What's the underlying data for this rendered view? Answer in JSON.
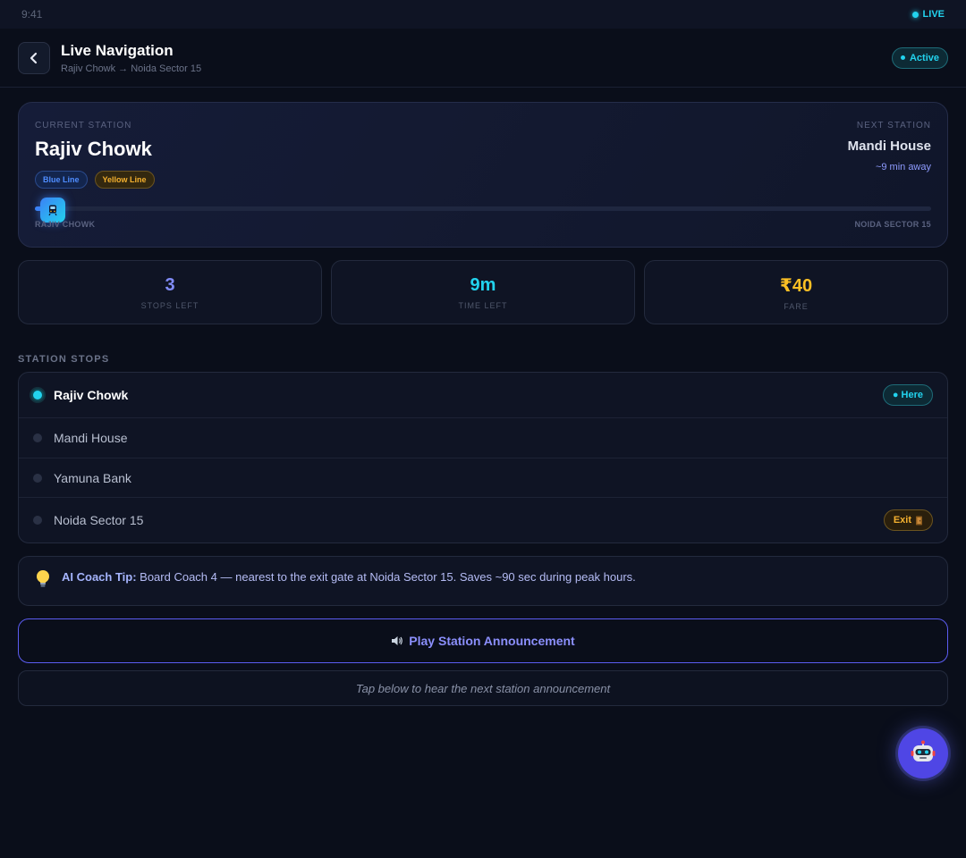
{
  "status": {
    "time": "9:41",
    "live": "LIVE"
  },
  "header": {
    "title": "Live Navigation",
    "subtitle": "Rajiv Chowk → Noida Sector 15",
    "badge": "Active"
  },
  "current": {
    "label": "CURRENT STATION",
    "name": "Rajiv Chowk",
    "lines": [
      "Blue Line",
      "Yellow Line"
    ]
  },
  "next": {
    "label": "NEXT STATION",
    "name": "Mandi House",
    "eta": "~9 min away"
  },
  "progress": {
    "fraction": 0.02,
    "start": "RAJIV CHOWK",
    "end": "NOIDA SECTOR 15"
  },
  "stats": [
    {
      "value": "3",
      "label": "STOPS LEFT",
      "color": "#818cf8"
    },
    {
      "value": "9m",
      "label": "TIME LEFT",
      "color": "#22d3ee"
    },
    {
      "value": "₹40",
      "label": "FARE",
      "color": "#fbbf24"
    }
  ],
  "stops_title": "STATION STOPS",
  "stops": [
    {
      "name": "Rajiv Chowk",
      "badge": "Here"
    },
    {
      "name": "Mandi House"
    },
    {
      "name": "Yamuna Bank"
    },
    {
      "name": "Noida Sector 15",
      "badge": "Exit"
    }
  ],
  "tip": {
    "lead": "AI Coach Tip:",
    "text": " Board Coach 4 — nearest to the exit gate at Noida Sector 15. Saves ~90 sec during peak hours."
  },
  "play_label": "Play Station Announcement",
  "hint": "Tap below to hear the next station announcement",
  "icons": {
    "back": "chevron-left-icon",
    "train": "train-icon",
    "tip": "lightbulb-icon",
    "play": "speaker-icon",
    "exit": "door-icon",
    "assistant": "robot-icon"
  }
}
